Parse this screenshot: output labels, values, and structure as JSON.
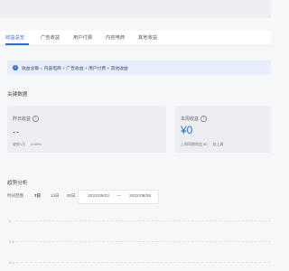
{
  "tabs": [
    {
      "label": "收益总览",
      "active": true
    },
    {
      "label": "广告收益",
      "active": false
    },
    {
      "label": "用户付费",
      "active": false
    },
    {
      "label": "内容电商",
      "active": false
    },
    {
      "label": "其他收益",
      "active": false
    }
  ],
  "notice": {
    "text": "收益总额 = 内容电商 + 广告收益 + 用户付费 + 其他收益"
  },
  "key_data": {
    "title": "关键数据",
    "cards": [
      {
        "label": "昨日收益",
        "value": "--",
        "compare_label": "较前1日",
        "compare_value": "0.00%"
      },
      {
        "label": "本周收益",
        "value": "¥0",
        "compare_label": "上周同期收益 ¥0",
        "compare_value": "较上周"
      }
    ]
  },
  "trend": {
    "title": "趋势分析",
    "filter_label": "时间范围",
    "filters": [
      "7日",
      "14日",
      "30日"
    ],
    "selected_filter": "7日",
    "date_start": "2022/08/02",
    "date_sep": "—",
    "date_end": "2022/08/08",
    "y_ticks": [
      "1",
      "0.8",
      "0.6"
    ]
  },
  "colors": {
    "accent": "#2b6be0",
    "notice_bg": "#e8eefc"
  }
}
